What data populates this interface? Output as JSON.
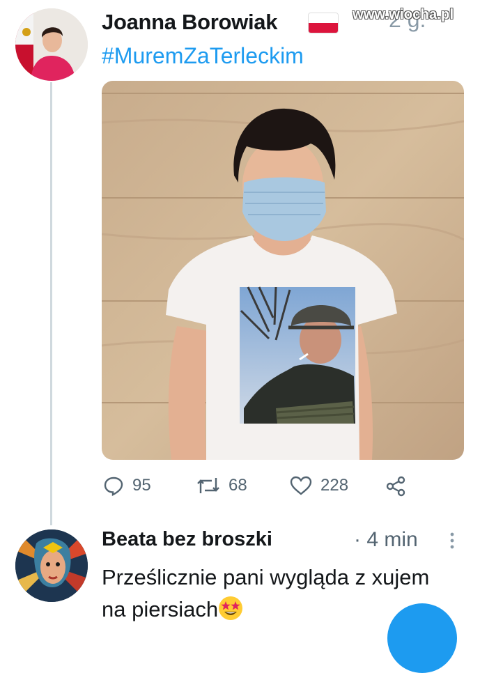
{
  "tweet": {
    "author_name": "Joanna Borowiak",
    "time_ago": "2 g.",
    "hashtag": "#MuremZaTerleckim",
    "flag": "poland-flag-icon",
    "stats": {
      "replies": "95",
      "retweets": "68",
      "likes": "228"
    }
  },
  "reply": {
    "author_name": "Beata bez broszki",
    "time": "· 4 min",
    "text": "Prześlicznie pani wygląda z xujem na piersiach",
    "emoji": "star-struck-emoji"
  },
  "watermark": "www.wiocha.pl",
  "icons": [
    "reply-icon",
    "retweet-icon",
    "like-icon",
    "share-icon",
    "more-vert-icon"
  ],
  "colors": {
    "accent": "#1d9bf0",
    "muted": "#536471",
    "thread_line": "#cfd9de",
    "flag_red": "#dc143c"
  }
}
